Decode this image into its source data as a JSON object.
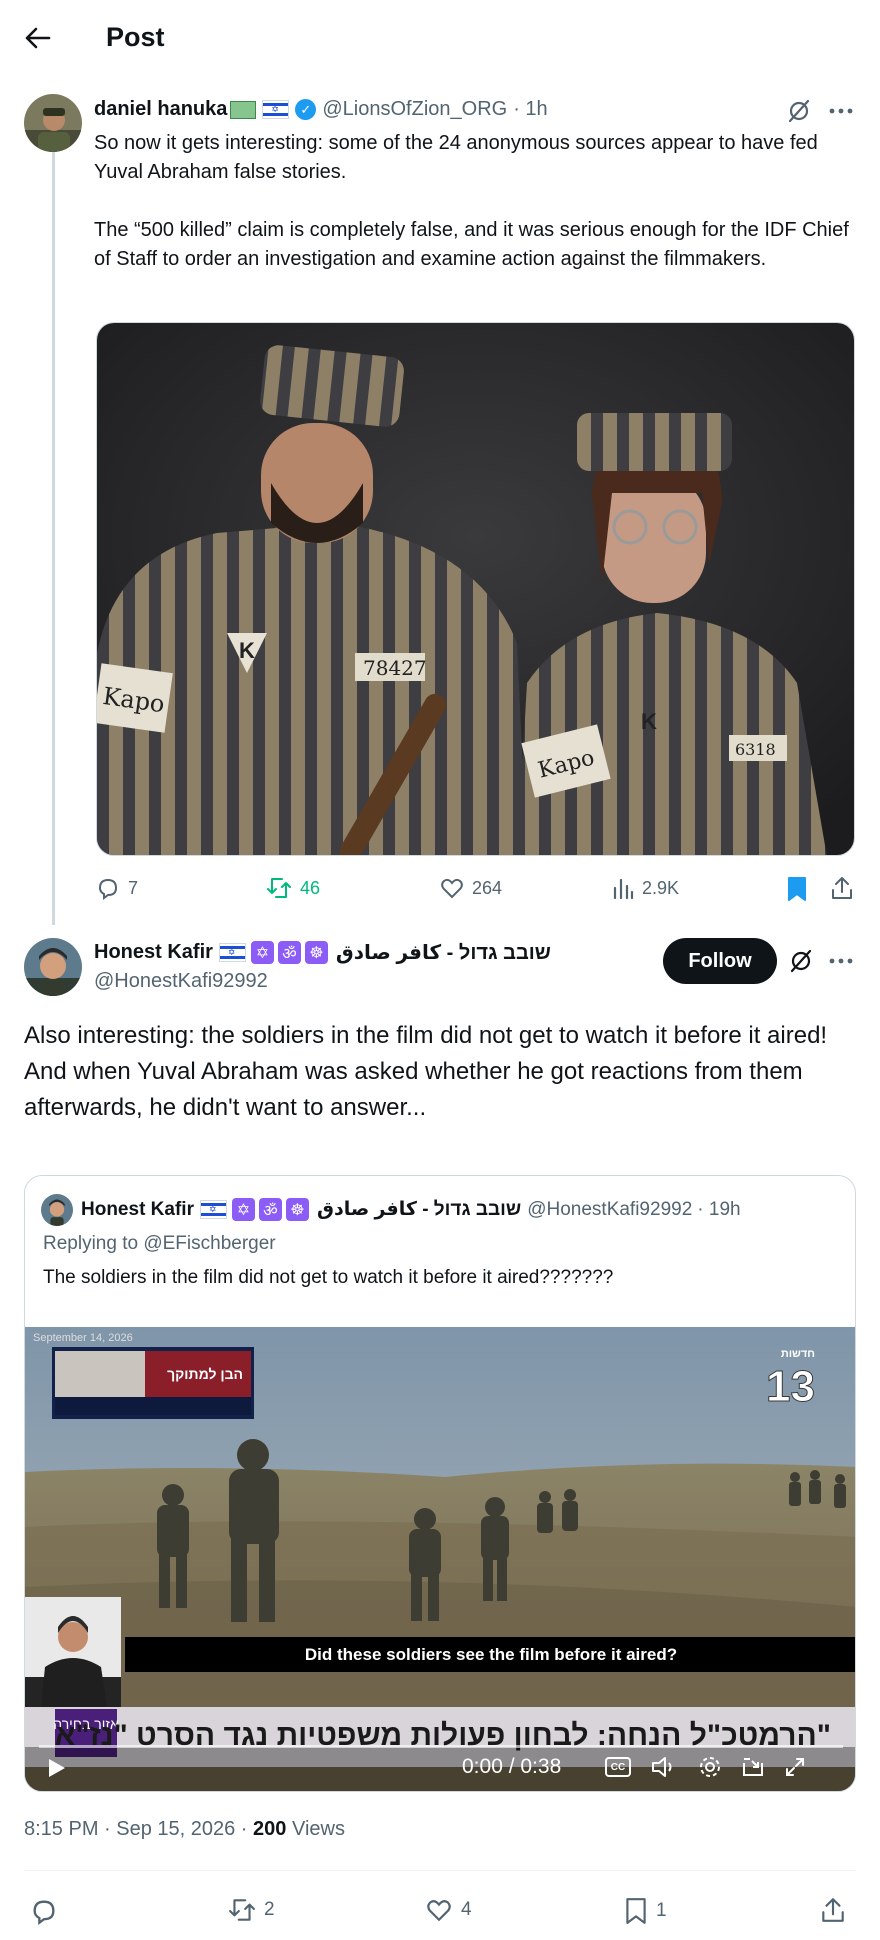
{
  "header": {
    "title": "Post"
  },
  "tweet1": {
    "name": "daniel hanuka",
    "handle": "@LionsOfZion_ORG",
    "time": "· 1h",
    "text": "So now it gets interesting: some of the 24 anonymous sources appear to have fed Yuval Abraham false stories.\n\nThe “500 killed” claim is completely false, and it was serious enough for the IDF Chief of Staff to order an investigation and examine action against the filmmakers.",
    "image_labels": {
      "armband_left": "Kapo",
      "armband_right": "Kapo",
      "patch_left": "78427",
      "patch_right": "6318",
      "badge_letter": "K"
    },
    "stats": {
      "replies": "7",
      "reposts": "46",
      "likes": "264",
      "views": "2.9K"
    }
  },
  "tweet2": {
    "name": "Honest Kafir",
    "name_suffix": "שובב גדול - كافر صادق",
    "handle": "@HonestKafi92992",
    "follow_label": "Follow",
    "text_line1": "Also interesting: the soldiers in the film did not get to watch it before it aired!",
    "text_line2": "And when Yuval Abraham was asked whether he got reactions from them afterwards, he didn't want to answer...",
    "posted": "8:15 PM · Sep 15, 2026 · ",
    "views_count": "200",
    "views_label": " Views",
    "stats": {
      "reposts": "2",
      "likes": "4",
      "bookmarks": "1"
    }
  },
  "quote": {
    "name": "Honest Kafir",
    "name_suffix": "שובב גדול - كافر صادق",
    "handle": "@HonestKafi92992",
    "time": "· 19h",
    "replying_to": "Replying to @EFischberger",
    "text": "The soldiers in the film did not get to watch it before it aired???????",
    "video": {
      "date_stamp": "September 14, 2026",
      "inset_label": "הבן למתוקך",
      "channel_label": "חדשות",
      "channel_number": "13",
      "subtitle": "Did these soldiers see the film before it aired?",
      "headline": "הרמטכ\"ל הנחה: לבחון פעולות משפטיות נגד הסרט \"נז\"א\"",
      "region_label": "אזור בחירה",
      "time": "0:00 / 0:38",
      "cc_label": "CC"
    }
  },
  "colors": {
    "accent": "#1d9bf0",
    "repost_active": "#00ba7c",
    "text": "#0f1419",
    "muted": "#536471"
  }
}
